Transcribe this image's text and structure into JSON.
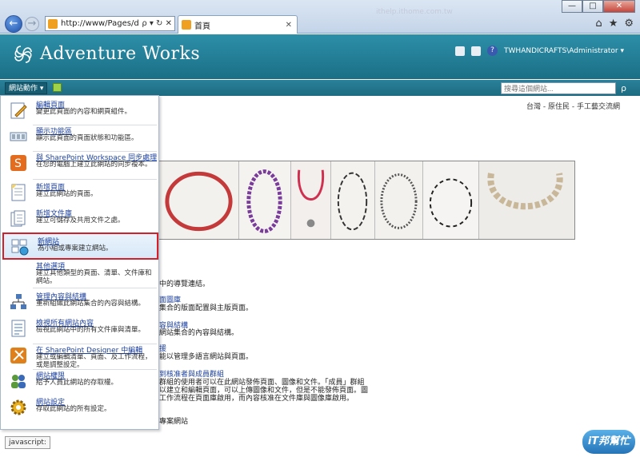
{
  "browser": {
    "address": "http://www/Pages/d",
    "address_controls": "ρ ▾ ↻ ✕",
    "tab_title": "首頁",
    "tab_close": "✕",
    "blurred_url": "ithelp.ithome.com.tw",
    "window_buttons": [
      "—",
      "□",
      "✕"
    ],
    "tools": [
      "⌂",
      "★",
      "⚙"
    ]
  },
  "header": {
    "site_title": "Adventure Works",
    "user": "TWHANDICRAFTS\\Administrator ▾",
    "help": "?"
  },
  "ribbon": {
    "site_actions": "網站動作 ▾",
    "search_placeholder": "搜尋這個網站...",
    "search_button": "ρ"
  },
  "breadcrumb": "台灣 - 原住民 - 手工藝交流網",
  "menu": {
    "items": [
      {
        "title": "編輯頁面",
        "desc": "變更此頁面的內容和網頁組件。"
      },
      {
        "title": "顯示功能區",
        "desc": "顯示此頁面的頁面狀態和功能區。"
      },
      {
        "title": "與 SharePoint Workspace 同步處理",
        "desc": "在您的電腦上建立此網站的同步複本。"
      },
      {
        "title": "新增頁面",
        "desc": "建立此網站的頁面。"
      },
      {
        "title": "新增文件庫",
        "desc": "建立可儲存及共用文件之處。"
      },
      {
        "title": "新網站",
        "desc": "為小組或專案建立網站。"
      },
      {
        "title": "其他選項",
        "desc": "建立其他類型的頁面、清單、文件庫和網站。"
      },
      {
        "title": "管理內容與結構",
        "desc": "重新組織此網站集合的內容與結構。"
      },
      {
        "title": "檢視所有網站內容",
        "desc": "檢視此網站中的所有文件庫與清單。"
      },
      {
        "title": "在 SharePoint Designer 中編輯",
        "desc": "建立或編輯清單、頁面、及工作流程，或是調整設定。"
      },
      {
        "title": "網站權限",
        "desc": "給予人員此網站的存取權。"
      },
      {
        "title": "網站設定",
        "desc": "存取此網站的所有設定。"
      }
    ]
  },
  "content": {
    "line1": "中的導覽連結。",
    "link2": "面圖庫",
    "line2": "集合的版面配置與主版頁面。",
    "link3": "容與結構",
    "line3": "網站集合的內容與結構。",
    "link4": "援",
    "line4": "能以管理多語言網站與頁面。",
    "link5": "到核准者與成員群組",
    "line5a": "群組的使用者可以在此網站發佈頁面、圖像和文件。「成員」群組",
    "line5b": "以建立和編輯頁面，可以上傳圖像和文件，但是不能發佈頁面。圖",
    "line5c": "工作流程在頁面庫啟用，而內容核准在文件庫與圖像庫啟用。",
    "line6": "專案網站"
  },
  "status": {
    "text": "javascript:"
  },
  "watermark": "iT邦幫忙",
  "colors": {
    "header": "#2d8fa8",
    "selected_border": "#d4202a",
    "link": "#1b3f9e"
  }
}
